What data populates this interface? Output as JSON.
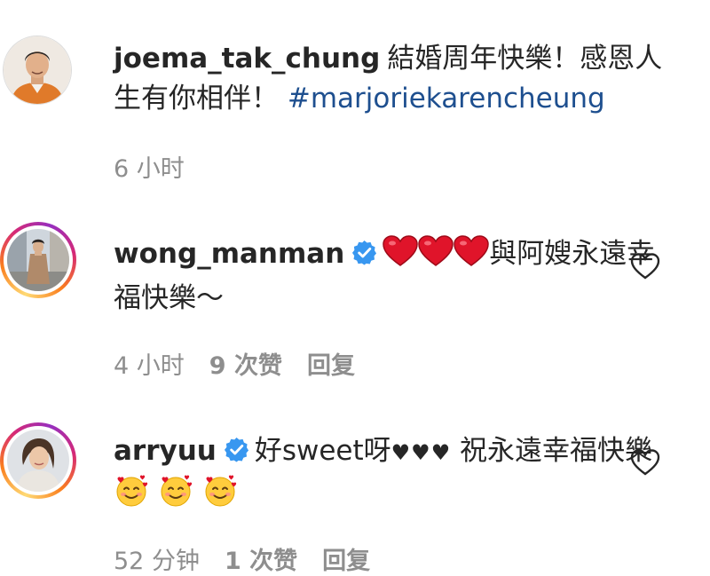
{
  "comments": [
    {
      "username": "joema_tak_chung",
      "text": "結婚周年快樂！感恩人生有你相伴！",
      "hashtag": "#marjoriekarencheung",
      "time": "6 小时",
      "avatar_icon": "profile-photo-man",
      "ring": false
    },
    {
      "username": "wong_manman",
      "verified": true,
      "emoji": "red-heart-icon",
      "text": "與阿嫂永遠幸福快樂～",
      "time": "4 小时",
      "likes": "9 次赞",
      "reply": "回复",
      "ring": true
    },
    {
      "username": "arryuu",
      "verified": true,
      "text_before": "好sweet呀",
      "hearts": "♥♥♥",
      "text_after": " 祝永遠幸福快樂",
      "emoji": "smiling-face-with-hearts-icon",
      "time": "52 分钟",
      "likes": "1 次赞",
      "reply": "回复",
      "ring": true
    }
  ],
  "colors": {
    "text": "#262626",
    "muted": "#8e8e8e",
    "hashtag": "#1e4f8f",
    "verified": "#3897f0",
    "heart": "#e0142a"
  }
}
